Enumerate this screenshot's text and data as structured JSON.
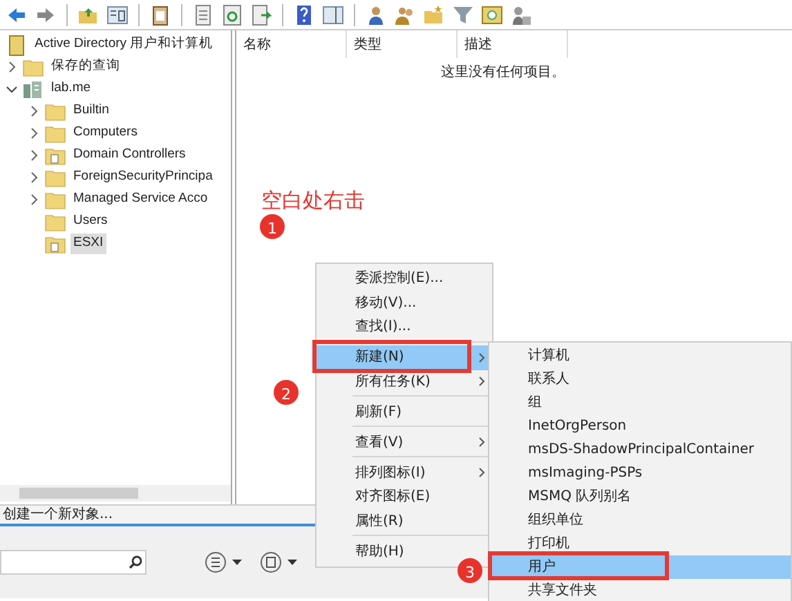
{
  "tree": {
    "items": [
      {
        "label": "Active Directory 用户和计算机",
        "kind": "console",
        "expandable": false,
        "selected": false,
        "children": [
          {
            "label": "保存的查询",
            "kind": "folder",
            "expandable": true,
            "expanded": false,
            "selected": false
          },
          {
            "label": "lab.me",
            "kind": "domain",
            "expandable": true,
            "expanded": true,
            "selected": false,
            "children": [
              {
                "label": "Builtin",
                "kind": "folder",
                "expandable": true,
                "expanded": false,
                "selected": false
              },
              {
                "label": "Computers",
                "kind": "folder",
                "expandable": true,
                "expanded": false,
                "selected": false
              },
              {
                "label": "Domain Controllers",
                "kind": "ou",
                "expandable": true,
                "expanded": false,
                "selected": false
              },
              {
                "label": "ForeignSecurityPrincipa",
                "kind": "folder",
                "expandable": true,
                "expanded": false,
                "selected": false
              },
              {
                "label": "Managed Service Acco",
                "kind": "folder",
                "expandable": true,
                "expanded": false,
                "selected": false
              },
              {
                "label": "Users",
                "kind": "folder",
                "expandable": false,
                "selected": false
              },
              {
                "label": "ESXI",
                "kind": "ou",
                "expandable": false,
                "selected": true
              }
            ]
          }
        ]
      }
    ]
  },
  "list": {
    "columns": [
      "名称",
      "类型",
      "描述"
    ],
    "empty_message": "这里没有任何项目。"
  },
  "status_bar": "创建一个新对象...",
  "context_menu": {
    "items": [
      {
        "label": "委派控制(E)...",
        "submenu": false,
        "separator_before": false,
        "selected": false
      },
      {
        "label": "移动(V)...",
        "submenu": false,
        "separator_before": false,
        "selected": false
      },
      {
        "label": "查找(I)...",
        "submenu": false,
        "separator_before": false,
        "selected": false
      },
      {
        "label": "新建(N)",
        "submenu": true,
        "separator_before": true,
        "selected": true
      },
      {
        "label": "所有任务(K)",
        "submenu": true,
        "separator_before": false,
        "selected": false
      },
      {
        "label": "刷新(F)",
        "submenu": false,
        "separator_before": true,
        "selected": false
      },
      {
        "label": "查看(V)",
        "submenu": true,
        "separator_before": true,
        "selected": false
      },
      {
        "label": "排列图标(I)",
        "submenu": true,
        "separator_before": true,
        "selected": false
      },
      {
        "label": "对齐图标(E)",
        "submenu": false,
        "separator_before": false,
        "selected": false
      },
      {
        "label": "属性(R)",
        "submenu": false,
        "separator_before": false,
        "selected": false
      },
      {
        "label": "帮助(H)",
        "submenu": false,
        "separator_before": true,
        "selected": false
      }
    ]
  },
  "submenu": {
    "items": [
      {
        "label": "计算机",
        "selected": false
      },
      {
        "label": "联系人",
        "selected": false
      },
      {
        "label": "组",
        "selected": false
      },
      {
        "label": "InetOrgPerson",
        "selected": false
      },
      {
        "label": "msDS-ShadowPrincipalContainer",
        "selected": false
      },
      {
        "label": "msImaging-PSPs",
        "selected": false
      },
      {
        "label": "MSMQ 队列别名",
        "selected": false
      },
      {
        "label": "组织单位",
        "selected": false
      },
      {
        "label": "打印机",
        "selected": false
      },
      {
        "label": "用户",
        "selected": true
      },
      {
        "label": "共享文件夹",
        "selected": false
      }
    ]
  },
  "annotations": {
    "hint": "空白处右击",
    "markers": [
      "1",
      "2",
      "3"
    ]
  }
}
